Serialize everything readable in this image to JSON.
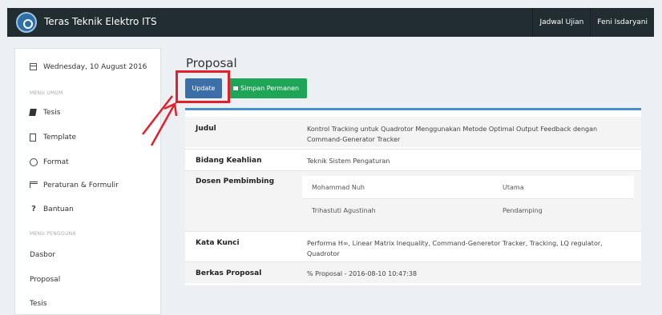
{
  "navbar": {
    "brand": "Teras Teknik Elektro ITS",
    "links": [
      "Jadwal Ujian",
      "Feni Isdaryani"
    ]
  },
  "sidebar": {
    "date": "Wednesday, 10 August 2016",
    "menu_umum_label": "MENU UMUM",
    "menu_umum": [
      {
        "label": "Tesis",
        "icon": "book-icon"
      },
      {
        "label": "Template",
        "icon": "file-icon"
      },
      {
        "label": "Format",
        "icon": "clock-icon"
      },
      {
        "label": "Peraturan & Formulir",
        "icon": "flag-icon"
      },
      {
        "label": "Bantuan",
        "icon": "question-icon"
      }
    ],
    "menu_pengguna_label": "MENU PENGGUNA",
    "menu_pengguna": [
      {
        "label": "Dasbor"
      },
      {
        "label": "Proposal"
      },
      {
        "label": "Tesis"
      }
    ]
  },
  "main": {
    "title": "Proposal",
    "update_label": "Update",
    "save_label": "Simpan Permanen",
    "fields": {
      "judul_key": "Judul",
      "judul_val": "Kontrol Tracking untuk Quadrotor Menggunakan Metode Optimal Output Feedback dengan Command-Generator Tracker",
      "bidang_key": "Bidang Keahlian",
      "bidang_val": "Teknik Sistem Pengaturan",
      "dosen_key": "Dosen Pembimbing",
      "dosen": [
        {
          "name": "Mohammad Nuh",
          "role": "Utama"
        },
        {
          "name": "Trihastuti Agustinah",
          "role": "Pendamping"
        }
      ],
      "kata_key": "Kata Kunci",
      "kata_val": "Performa H∞, Linear Matrix Inequality, Command-Generetor Tracker, Tracking, LQ regulator, Quadrotor",
      "berkas_key": "Berkas Proposal",
      "berkas_val": "Proposal - 2016-08-10 10:47:38"
    }
  },
  "colors": {
    "navbar": "#222d32",
    "update_button": "#3c6fa8",
    "save_button": "#1fa558",
    "highlight": "#e0202a",
    "link": "#3c8dbc"
  }
}
